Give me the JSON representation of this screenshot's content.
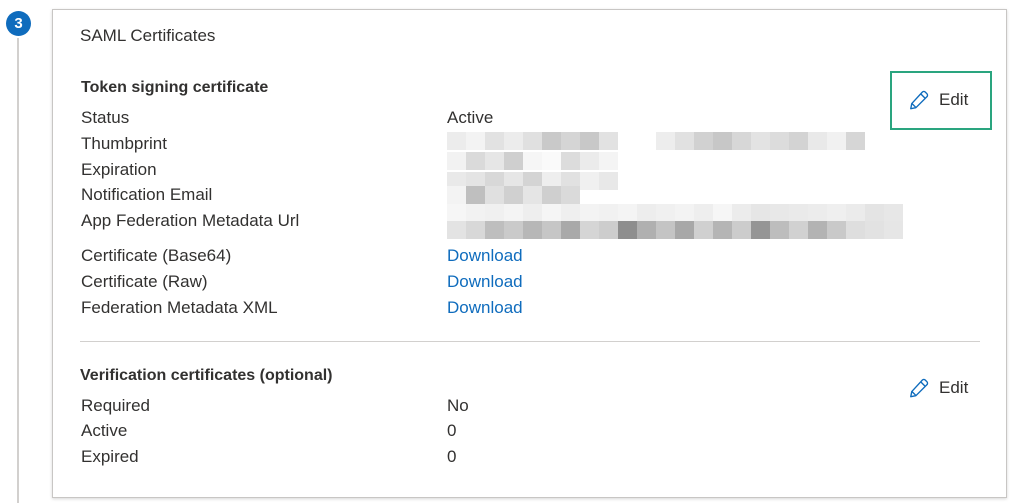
{
  "step": {
    "number": "3"
  },
  "card": {
    "title": "SAML Certificates"
  },
  "token_signing": {
    "title": "Token signing certificate",
    "edit_label": "Edit",
    "status_label": "Status",
    "status_value": "Active",
    "thumbprint_label": "Thumbprint",
    "expiration_label": "Expiration",
    "notification_email_label": "Notification Email",
    "metadata_url_label": "App Federation Metadata Url",
    "cert_base64_label": "Certificate (Base64)",
    "cert_base64_link": "Download",
    "cert_raw_label": "Certificate (Raw)",
    "cert_raw_link": "Download",
    "federation_xml_label": "Federation Metadata XML",
    "federation_xml_link": "Download"
  },
  "verification": {
    "title": "Verification certificates (optional)",
    "edit_label": "Edit",
    "required_label": "Required",
    "required_value": "No",
    "active_label": "Active",
    "active_value": "0",
    "expired_label": "Expired",
    "expired_value": "0"
  },
  "colors": {
    "link": "#0f6cbd",
    "step_badge": "#0f6cbd",
    "highlight_border": "#2aa57f",
    "text": "#323130"
  },
  "icons": {
    "edit": "pencil-icon"
  }
}
